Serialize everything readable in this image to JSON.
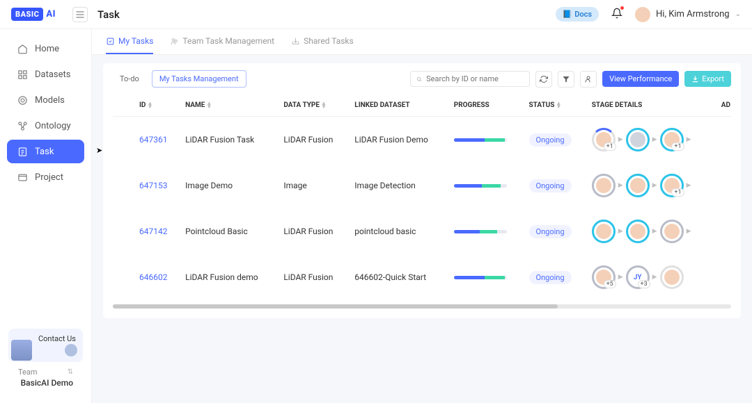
{
  "header": {
    "logo_box": "BASIC",
    "logo_text": "AI",
    "page_title": "Task",
    "docs_label": "Docs",
    "greeting": "Hi, Kim Armstrong"
  },
  "sidebar": {
    "items": [
      {
        "label": "Home",
        "icon": "home"
      },
      {
        "label": "Datasets",
        "icon": "datasets"
      },
      {
        "label": "Models",
        "icon": "models"
      },
      {
        "label": "Ontology",
        "icon": "ontology"
      },
      {
        "label": "Task",
        "icon": "task",
        "active": true
      },
      {
        "label": "Project",
        "icon": "project"
      }
    ],
    "contact_us": "Contact Us",
    "team_label": "Team",
    "team_name": "BasicAI Demo"
  },
  "tabs": [
    {
      "label": "My Tasks",
      "active": true
    },
    {
      "label": "Team Task Management"
    },
    {
      "label": "Shared Tasks"
    }
  ],
  "panel": {
    "todo_label": "To-do",
    "mgmt_label": "My Tasks Management",
    "search_placeholder": "Search by ID or name",
    "view_perf_label": "View Performance",
    "export_label": "Export"
  },
  "columns": {
    "id": "ID",
    "name": "NAME",
    "data_type": "DATA TYPE",
    "linked_dataset": "LINKED DATASET",
    "progress": "PROGRESS",
    "status": "STATUS",
    "stage_details": "STAGE DETAILS",
    "admin": "AD"
  },
  "rows": [
    {
      "id": "647361",
      "name": "LiDAR Fusion Task",
      "data_type": "LiDAR Fusion",
      "linked_dataset": "LiDAR Fusion Demo",
      "progress_pct": 96,
      "status": "Ongoing",
      "stages": [
        {
          "ring": "c-partial",
          "avatar": "color",
          "badge": "+1"
        },
        {
          "ring": "c-blue",
          "avatar": "grey",
          "badge": ""
        },
        {
          "ring": "c-blue",
          "avatar": "color",
          "badge": "+1"
        }
      ]
    },
    {
      "id": "647153",
      "name": "Image Demo",
      "data_type": "Image",
      "linked_dataset": "Image Detection",
      "progress_pct": 88,
      "status": "Ongoing",
      "stages": [
        {
          "ring": "c-grey",
          "avatar": "color",
          "badge": ""
        },
        {
          "ring": "c-blue",
          "avatar": "color",
          "badge": ""
        },
        {
          "ring": "c-blue",
          "avatar": "color",
          "badge": "+1"
        }
      ]
    },
    {
      "id": "647142",
      "name": "Pointcloud Basic",
      "data_type": "LiDAR Fusion",
      "linked_dataset": "pointcloud basic",
      "progress_pct": 82,
      "status": "Ongoing",
      "stages": [
        {
          "ring": "c-blue",
          "avatar": "color",
          "badge": ""
        },
        {
          "ring": "c-blue",
          "avatar": "color",
          "badge": ""
        },
        {
          "ring": "c-grey",
          "avatar": "color",
          "badge": ""
        }
      ]
    },
    {
      "id": "646602",
      "name": "LiDAR Fusion demo",
      "data_type": "LiDAR Fusion",
      "linked_dataset": "646602-Quick Start",
      "progress_pct": 97,
      "status": "Ongoing",
      "stages": [
        {
          "ring": "c-grey",
          "avatar": "color",
          "badge": "+5"
        },
        {
          "ring": "c-grey",
          "avatar": "jy",
          "badge": "+3"
        },
        {
          "ring": "",
          "avatar": "color",
          "badge": ""
        }
      ]
    }
  ]
}
